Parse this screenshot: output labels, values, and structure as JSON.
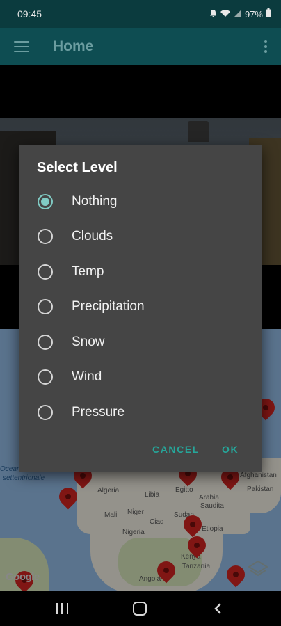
{
  "status_bar": {
    "time": "09:45",
    "battery": "97%",
    "icons": [
      "notification-icon",
      "wifi-icon",
      "signal-icon",
      "battery-icon"
    ]
  },
  "app_bar": {
    "title": "Home",
    "icons": [
      "menu-icon",
      "more-vert-icon"
    ]
  },
  "map": {
    "labels": {
      "ocean": "Oceano",
      "ocean2": "settentrionale",
      "libia": "Libia",
      "egitto": "Egitto",
      "algeria": "Algeria",
      "mali": "Mali",
      "niger": "Niger",
      "ciad": "Ciad",
      "sudan": "Sudan",
      "nigeria": "Nigeria",
      "arabia": "Arabia",
      "saudita": "Saudita",
      "afghanistan": "Afghanistan",
      "pakistan": "Pakistan",
      "etiopia": "Etiopia",
      "tanzania": "Tanzania",
      "angola": "Angola",
      "kenya": "Kenya"
    },
    "google_logo": "Google",
    "land_color": "#e3e0d6",
    "water_color": "#8bb1d9",
    "pin_color": "#c5221f"
  },
  "dialog": {
    "title": "Select Level",
    "options": [
      {
        "label": "Nothing",
        "selected": true
      },
      {
        "label": "Clouds",
        "selected": false
      },
      {
        "label": "Temp",
        "selected": false
      },
      {
        "label": "Precipitation",
        "selected": false
      },
      {
        "label": "Snow",
        "selected": false
      },
      {
        "label": "Wind",
        "selected": false
      },
      {
        "label": "Pressure",
        "selected": false
      }
    ],
    "cancel_label": "CANCEL",
    "ok_label": "OK",
    "accent_color": "#26a69a"
  },
  "nav_bar": {
    "icons": [
      "recent-apps-icon",
      "home-icon",
      "back-icon"
    ]
  }
}
